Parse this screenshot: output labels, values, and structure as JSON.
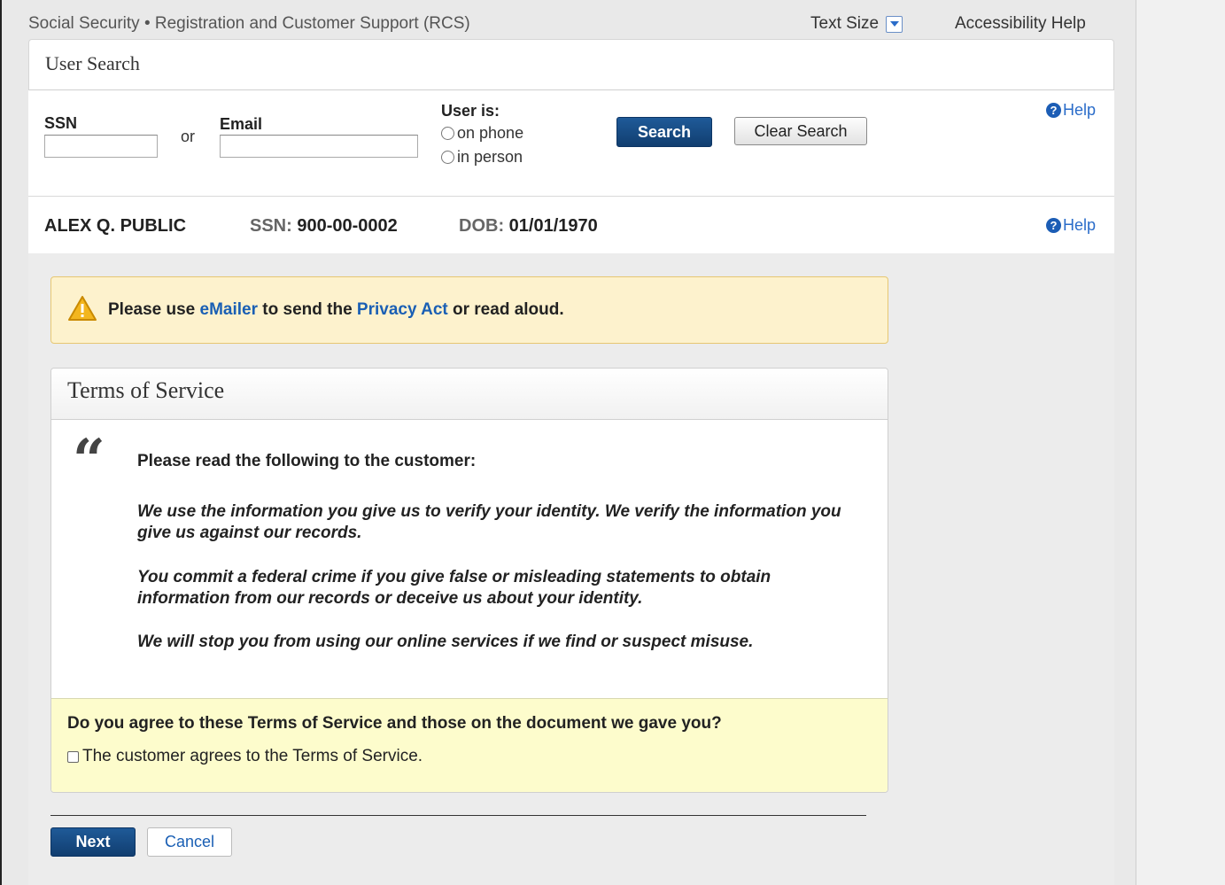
{
  "header": {
    "app_title": "Social Security • Registration and Customer Support (RCS)",
    "text_size": "Text Size",
    "accessibility_help": "Accessibility Help"
  },
  "user_search": {
    "title": "User Search",
    "ssn_label": "SSN",
    "ssn_value": "",
    "or_label": "or",
    "email_label": "Email",
    "email_value": "",
    "user_is_label": "User is:",
    "options": [
      "on phone",
      "in person"
    ],
    "search_button": "Search",
    "clear_button": "Clear Search",
    "help": "Help"
  },
  "customer": {
    "name": "ALEX Q. PUBLIC",
    "ssn_label": "SSN:",
    "ssn": "900-00-0002",
    "dob_label": "DOB:",
    "dob": "01/01/1970",
    "help": "Help"
  },
  "alert": {
    "pre": "Please use ",
    "link1": "eMailer",
    "mid": " to send the ",
    "link2": "Privacy Act",
    "post": " or read aloud."
  },
  "terms": {
    "title": "Terms of Service",
    "lead": "Please read the following to the customer:",
    "paragraphs": [
      "We use the information you give us to verify your identity. We verify the information you give us against our records.",
      "You commit a federal crime if you give false or misleading statements to obtain information from our records or deceive us about your identity.",
      "We will stop you from using our online services if we find or suspect misuse."
    ],
    "question": "Do you agree to these Terms of Service and those on the document we gave you?",
    "checkbox_label": "The customer agrees to the Terms of Service."
  },
  "actions": {
    "next": "Next",
    "cancel": "Cancel"
  },
  "colors": {
    "primary": "#14477f",
    "link": "#1a5fb4",
    "alert_bg": "#fdf2cd",
    "agree_bg": "#fdfccc"
  },
  "icons": [
    "dropdown-icon",
    "help-icon",
    "warning-icon",
    "quote-icon"
  ]
}
